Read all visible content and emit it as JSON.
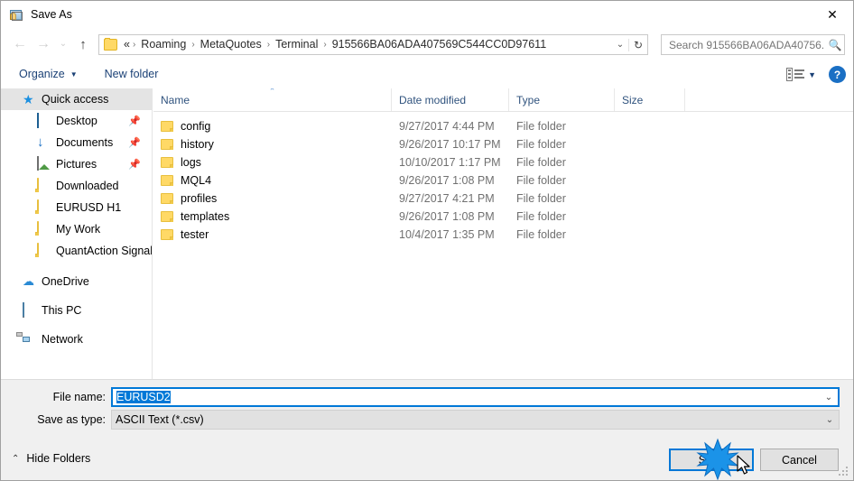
{
  "window": {
    "title": "Save As",
    "icon": "save-as-app-icon",
    "close_label": "✕"
  },
  "nav": {
    "back": "←",
    "forward": "→",
    "recent": "⌄",
    "up": "↑",
    "address": {
      "folder_icon": "folder-icon",
      "prefix": "«",
      "crumbs": [
        "Roaming",
        "MetaQuotes",
        "Terminal",
        "915566BA06ADA407569C544CC0D97611"
      ],
      "separator": "›",
      "dropdown": "⌄",
      "refresh": "↻"
    },
    "search": {
      "placeholder": "Search 915566BA06ADA40756...",
      "value": "",
      "icon": "search-icon"
    }
  },
  "toolbar": {
    "organize_label": "Organize",
    "organize_caret": "▼",
    "new_folder_label": "New folder",
    "view_caret": "▼",
    "help_label": "?"
  },
  "sidebar": {
    "items": [
      {
        "label": "Quick access",
        "icon": "star-icon",
        "level": 1,
        "selected": true,
        "pinned": false
      },
      {
        "label": "Desktop",
        "icon": "desktop-icon",
        "level": 2,
        "selected": false,
        "pinned": true
      },
      {
        "label": "Documents",
        "icon": "downloads-arrow-icon",
        "level": 2,
        "selected": false,
        "pinned": true
      },
      {
        "label": "Pictures",
        "icon": "pictures-icon",
        "level": 2,
        "selected": false,
        "pinned": true
      },
      {
        "label": "Downloaded",
        "icon": "folder-icon",
        "level": 2,
        "selected": false,
        "pinned": false
      },
      {
        "label": "EURUSD H1",
        "icon": "folder-icon",
        "level": 2,
        "selected": false,
        "pinned": false
      },
      {
        "label": "My Work",
        "icon": "folder-icon",
        "level": 2,
        "selected": false,
        "pinned": false
      },
      {
        "label": "QuantAction Signal",
        "icon": "folder-icon",
        "level": 2,
        "selected": false,
        "pinned": false
      },
      {
        "label": "OneDrive",
        "icon": "cloud-icon",
        "level": 1,
        "selected": false,
        "pinned": false
      },
      {
        "label": "This PC",
        "icon": "computer-icon",
        "level": 1,
        "selected": false,
        "pinned": false
      },
      {
        "label": "Network",
        "icon": "network-icon",
        "level": 1,
        "selected": false,
        "pinned": false
      }
    ],
    "pin_glyph": "📌"
  },
  "filelist": {
    "columns": [
      "Name",
      "Date modified",
      "Type",
      "Size"
    ],
    "sort_caret": "⌃",
    "rows": [
      {
        "name": "config",
        "date": "9/27/2017 4:44 PM",
        "type": "File folder",
        "size": ""
      },
      {
        "name": "history",
        "date": "9/26/2017 10:17 PM",
        "type": "File folder",
        "size": ""
      },
      {
        "name": "logs",
        "date": "10/10/2017 1:17 PM",
        "type": "File folder",
        "size": ""
      },
      {
        "name": "MQL4",
        "date": "9/26/2017 1:08 PM",
        "type": "File folder",
        "size": ""
      },
      {
        "name": "profiles",
        "date": "9/27/2017 4:21 PM",
        "type": "File folder",
        "size": ""
      },
      {
        "name": "templates",
        "date": "9/26/2017 1:08 PM",
        "type": "File folder",
        "size": ""
      },
      {
        "name": "tester",
        "date": "10/4/2017 1:35 PM",
        "type": "File folder",
        "size": ""
      }
    ]
  },
  "form": {
    "filename_label": "File name:",
    "filename_value": "EURUSD2",
    "filetype_label": "Save as type:",
    "filetype_value": "ASCII Text (*.csv)",
    "caret": "⌄"
  },
  "footer": {
    "hide_folders_label": "Hide Folders",
    "hide_folders_caret": "⌃",
    "save_label": "Save",
    "cancel_label": "Cancel"
  },
  "colors": {
    "accent": "#0078d7",
    "selection": "#0078d7",
    "folder": "#ffd966",
    "header_text": "#30537e",
    "toolbar_link": "#1b4176",
    "sidebar_selected": "#e4e4e4"
  }
}
